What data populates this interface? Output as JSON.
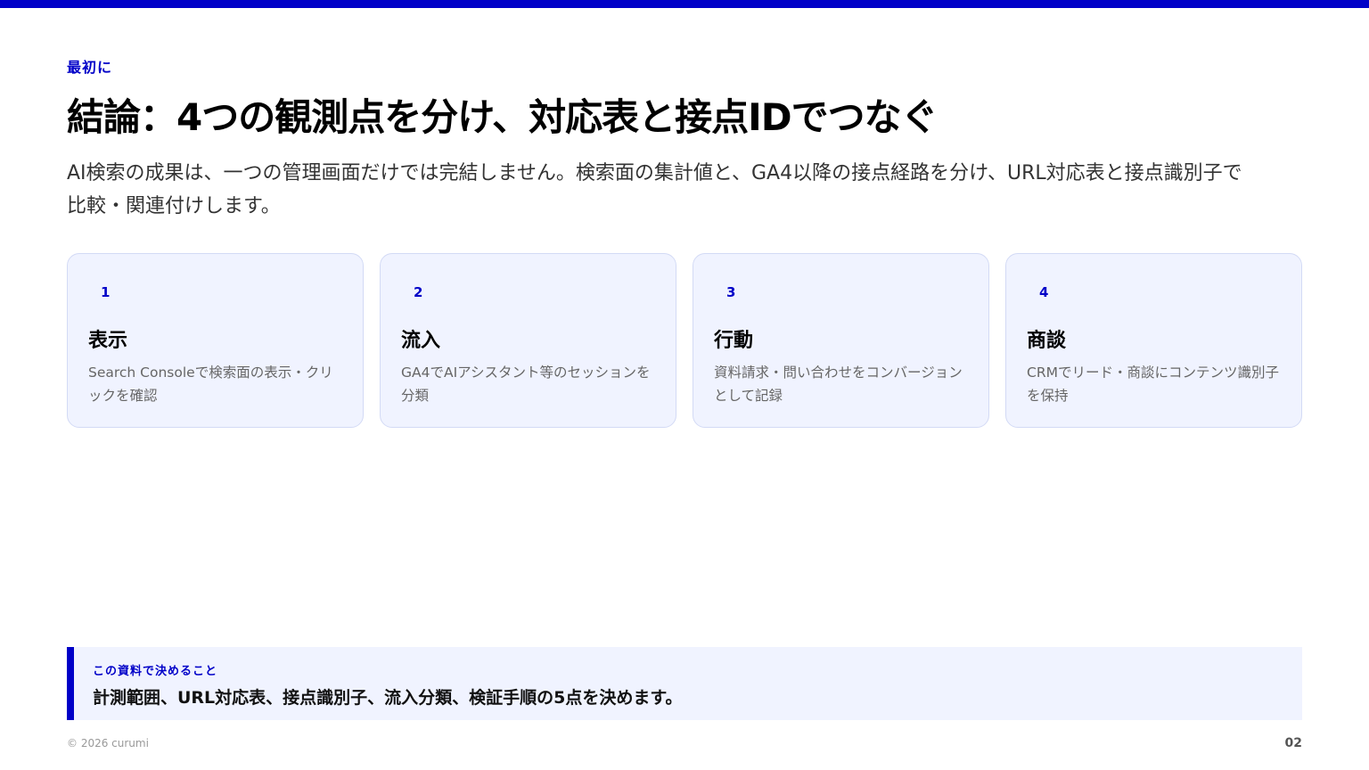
{
  "header": {
    "eyebrow": "最初に",
    "title": "結論：4つの観測点を分け、対応表と接点IDでつなぐ",
    "lead": "AI検索の成果は、一つの管理画面だけでは完結しません。検索面の集計値と、GA4以降の接点経路を分け、URL対応表と接点識別子で比較・関連付けします。"
  },
  "cards": [
    {
      "num": "1",
      "title": "表示",
      "desc": "Search Consoleで検索面の表示・クリックを確認"
    },
    {
      "num": "2",
      "title": "流入",
      "desc": "GA4でAIアシスタント等のセッションを分類"
    },
    {
      "num": "3",
      "title": "行動",
      "desc": "資料請求・問い合わせをコンバージョンとして記録"
    },
    {
      "num": "4",
      "title": "商談",
      "desc": "CRMでリード・商談にコンテンツ識別子を保持"
    }
  ],
  "callout": {
    "label": "この資料で決めること",
    "text": "計測範囲、URL対応表、接点識別子、流入分類、検証手順の5点を決めます。"
  },
  "footer": {
    "copyright": "© 2026 curumi",
    "page": "02"
  },
  "colors": {
    "accent": "#0000c8",
    "card_bg": "#f0f3ff",
    "card_border": "#d3daf5"
  }
}
